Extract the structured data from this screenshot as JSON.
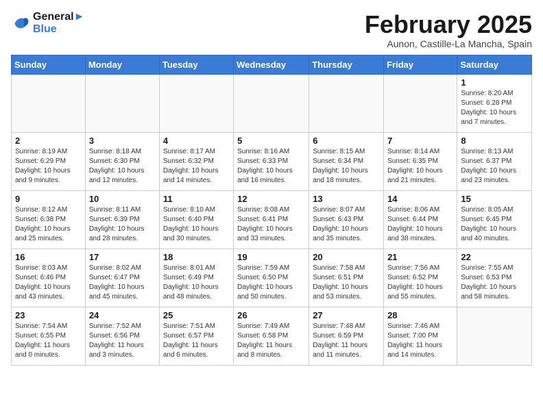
{
  "header": {
    "logo_line1": "General",
    "logo_line2": "Blue",
    "month_title": "February 2025",
    "location": "Aunon, Castille-La Mancha, Spain"
  },
  "weekdays": [
    "Sunday",
    "Monday",
    "Tuesday",
    "Wednesday",
    "Thursday",
    "Friday",
    "Saturday"
  ],
  "weeks": [
    [
      {
        "day": "",
        "info": ""
      },
      {
        "day": "",
        "info": ""
      },
      {
        "day": "",
        "info": ""
      },
      {
        "day": "",
        "info": ""
      },
      {
        "day": "",
        "info": ""
      },
      {
        "day": "",
        "info": ""
      },
      {
        "day": "1",
        "info": "Sunrise: 8:20 AM\nSunset: 6:28 PM\nDaylight: 10 hours and 7 minutes."
      }
    ],
    [
      {
        "day": "2",
        "info": "Sunrise: 8:19 AM\nSunset: 6:29 PM\nDaylight: 10 hours and 9 minutes."
      },
      {
        "day": "3",
        "info": "Sunrise: 8:18 AM\nSunset: 6:30 PM\nDaylight: 10 hours and 12 minutes."
      },
      {
        "day": "4",
        "info": "Sunrise: 8:17 AM\nSunset: 6:32 PM\nDaylight: 10 hours and 14 minutes."
      },
      {
        "day": "5",
        "info": "Sunrise: 8:16 AM\nSunset: 6:33 PM\nDaylight: 10 hours and 16 minutes."
      },
      {
        "day": "6",
        "info": "Sunrise: 8:15 AM\nSunset: 6:34 PM\nDaylight: 10 hours and 18 minutes."
      },
      {
        "day": "7",
        "info": "Sunrise: 8:14 AM\nSunset: 6:35 PM\nDaylight: 10 hours and 21 minutes."
      },
      {
        "day": "8",
        "info": "Sunrise: 8:13 AM\nSunset: 6:37 PM\nDaylight: 10 hours and 23 minutes."
      }
    ],
    [
      {
        "day": "9",
        "info": "Sunrise: 8:12 AM\nSunset: 6:38 PM\nDaylight: 10 hours and 25 minutes."
      },
      {
        "day": "10",
        "info": "Sunrise: 8:11 AM\nSunset: 6:39 PM\nDaylight: 10 hours and 28 minutes."
      },
      {
        "day": "11",
        "info": "Sunrise: 8:10 AM\nSunset: 6:40 PM\nDaylight: 10 hours and 30 minutes."
      },
      {
        "day": "12",
        "info": "Sunrise: 8:08 AM\nSunset: 6:41 PM\nDaylight: 10 hours and 33 minutes."
      },
      {
        "day": "13",
        "info": "Sunrise: 8:07 AM\nSunset: 6:43 PM\nDaylight: 10 hours and 35 minutes."
      },
      {
        "day": "14",
        "info": "Sunrise: 8:06 AM\nSunset: 6:44 PM\nDaylight: 10 hours and 38 minutes."
      },
      {
        "day": "15",
        "info": "Sunrise: 8:05 AM\nSunset: 6:45 PM\nDaylight: 10 hours and 40 minutes."
      }
    ],
    [
      {
        "day": "16",
        "info": "Sunrise: 8:03 AM\nSunset: 6:46 PM\nDaylight: 10 hours and 43 minutes."
      },
      {
        "day": "17",
        "info": "Sunrise: 8:02 AM\nSunset: 6:47 PM\nDaylight: 10 hours and 45 minutes."
      },
      {
        "day": "18",
        "info": "Sunrise: 8:01 AM\nSunset: 6:49 PM\nDaylight: 10 hours and 48 minutes."
      },
      {
        "day": "19",
        "info": "Sunrise: 7:59 AM\nSunset: 6:50 PM\nDaylight: 10 hours and 50 minutes."
      },
      {
        "day": "20",
        "info": "Sunrise: 7:58 AM\nSunset: 6:51 PM\nDaylight: 10 hours and 53 minutes."
      },
      {
        "day": "21",
        "info": "Sunrise: 7:56 AM\nSunset: 6:52 PM\nDaylight: 10 hours and 55 minutes."
      },
      {
        "day": "22",
        "info": "Sunrise: 7:55 AM\nSunset: 6:53 PM\nDaylight: 10 hours and 58 minutes."
      }
    ],
    [
      {
        "day": "23",
        "info": "Sunrise: 7:54 AM\nSunset: 6:55 PM\nDaylight: 11 hours and 0 minutes."
      },
      {
        "day": "24",
        "info": "Sunrise: 7:52 AM\nSunset: 6:56 PM\nDaylight: 11 hours and 3 minutes."
      },
      {
        "day": "25",
        "info": "Sunrise: 7:51 AM\nSunset: 6:57 PM\nDaylight: 11 hours and 6 minutes."
      },
      {
        "day": "26",
        "info": "Sunrise: 7:49 AM\nSunset: 6:58 PM\nDaylight: 11 hours and 8 minutes."
      },
      {
        "day": "27",
        "info": "Sunrise: 7:48 AM\nSunset: 6:59 PM\nDaylight: 11 hours and 11 minutes."
      },
      {
        "day": "28",
        "info": "Sunrise: 7:46 AM\nSunset: 7:00 PM\nDaylight: 11 hours and 14 minutes."
      },
      {
        "day": "",
        "info": ""
      }
    ]
  ]
}
